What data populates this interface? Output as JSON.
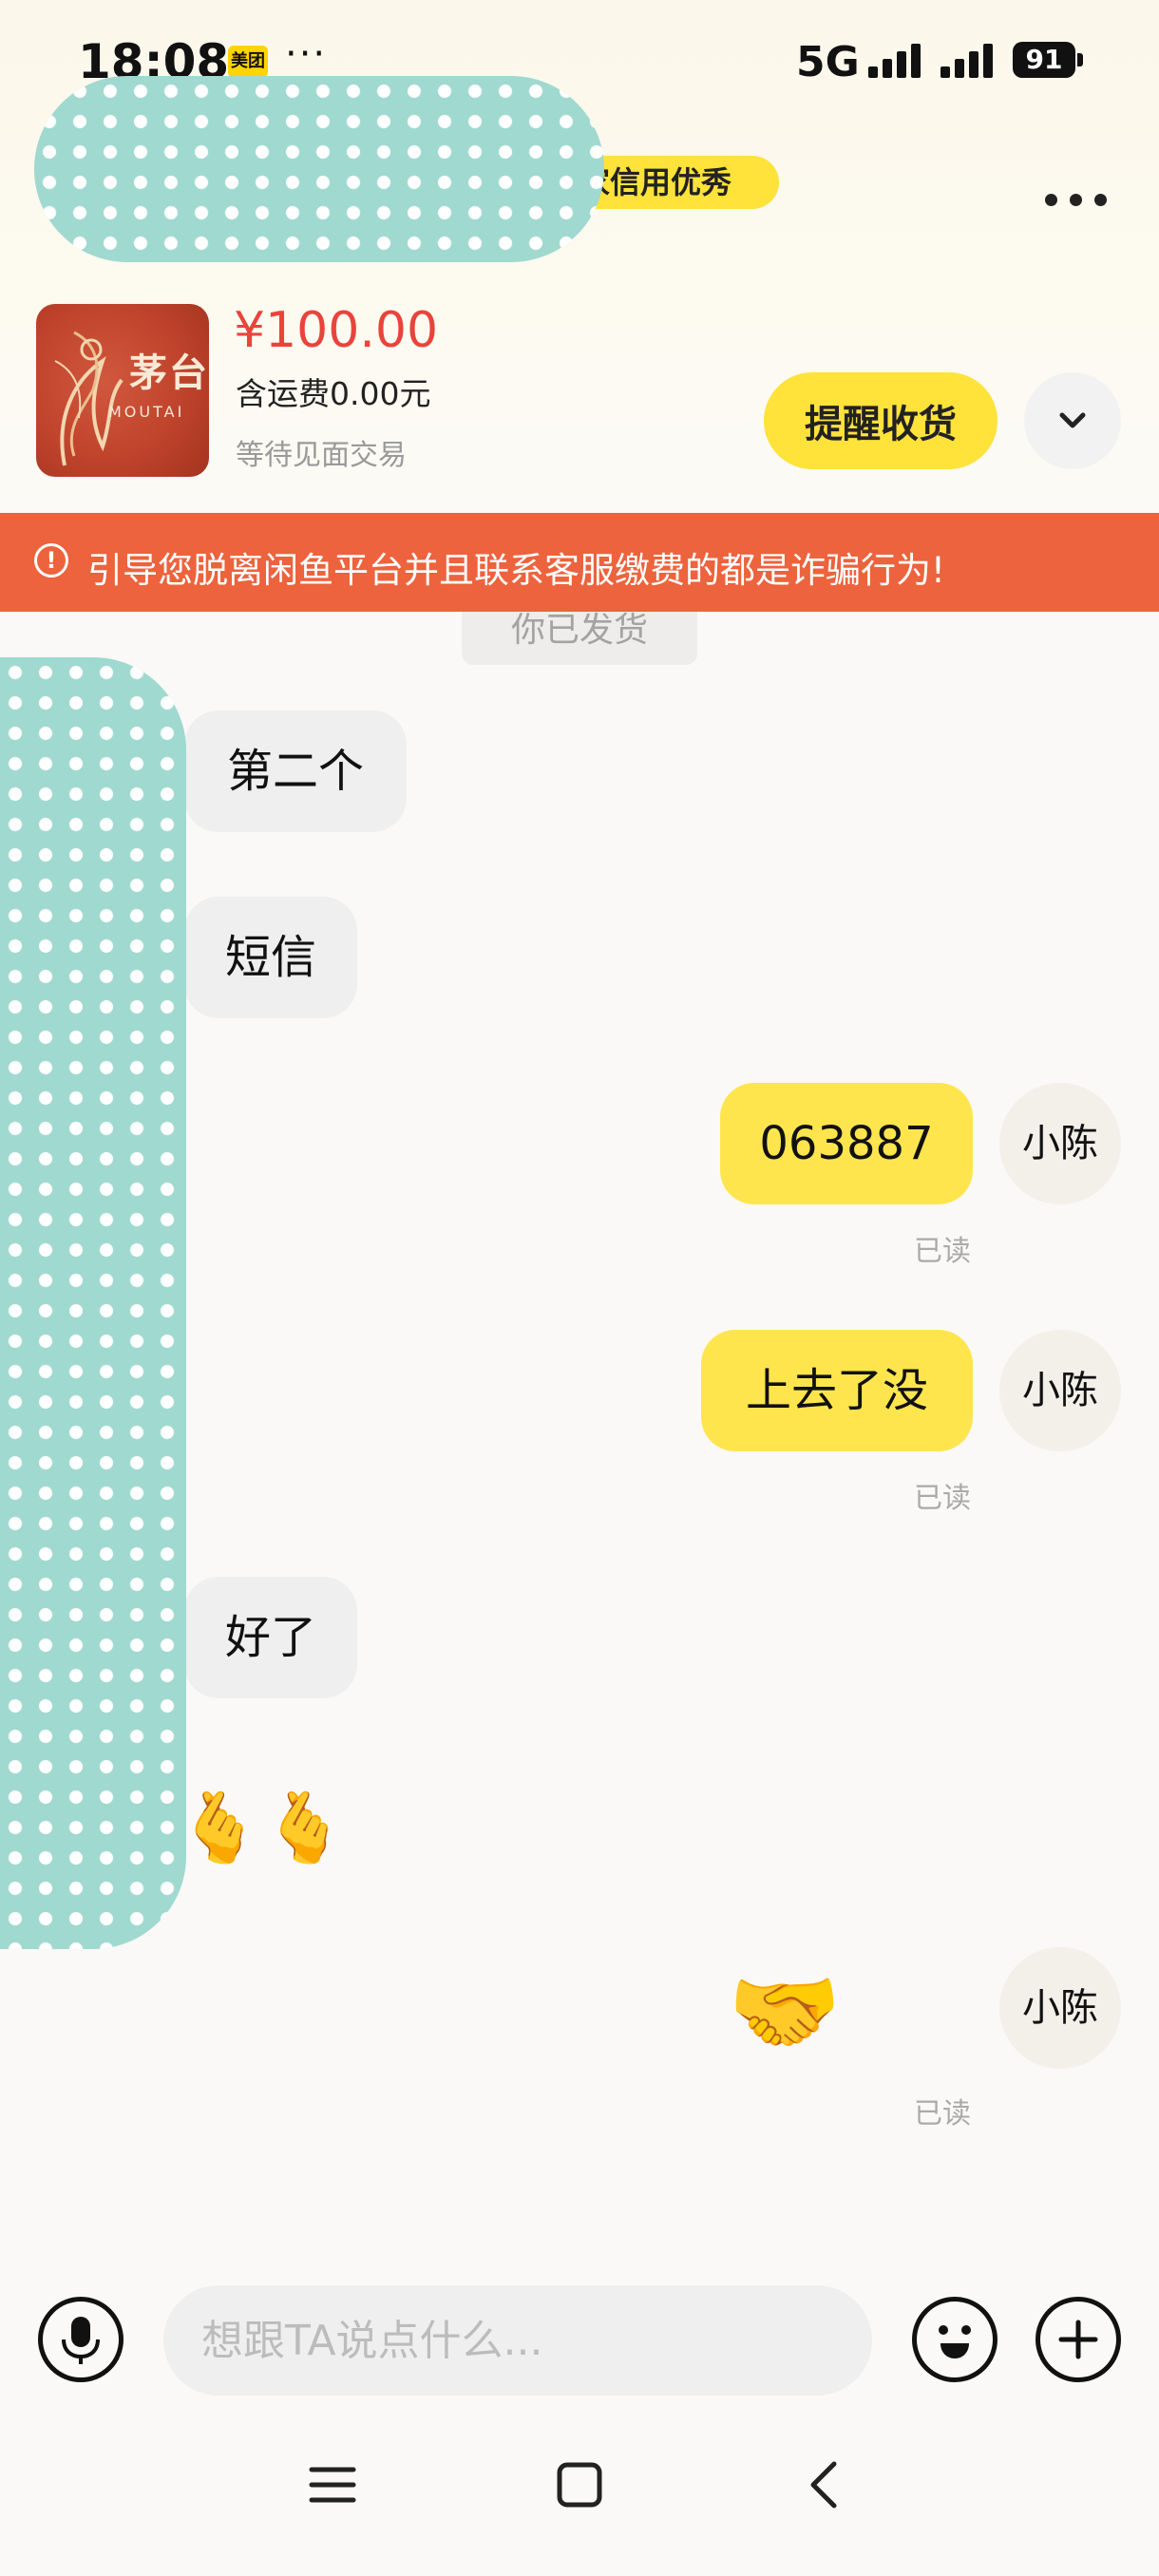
{
  "status_bar": {
    "time": "18:08",
    "app_badge": "美团",
    "more": "···",
    "network": "5G",
    "battery": "91"
  },
  "header": {
    "credit_badge": "家信用优秀",
    "menu_icon": "more-horizontal-icon"
  },
  "product": {
    "thumb_title": "茅台",
    "thumb_sub": "MOUTAI",
    "price": "¥100.00",
    "shipping": "含运费0.00元",
    "status": "等待见面交易",
    "remind_button": "提醒收货",
    "expand_icon": "chevron-down-icon"
  },
  "warning": {
    "icon": "alert-circle-icon",
    "text": "引导您脱离闲鱼平台并且联系客服缴费的都是诈骗行为!"
  },
  "chat": {
    "system_notice": "你已发货",
    "messages": [
      {
        "side": "in",
        "text": "第二个"
      },
      {
        "side": "in",
        "text": "短信"
      },
      {
        "side": "out",
        "text": "063887",
        "status": "已读",
        "avatar": "小陈"
      },
      {
        "side": "out",
        "text": "上去了没",
        "status": "已读",
        "avatar": "小陈"
      },
      {
        "side": "in",
        "text": "好了"
      },
      {
        "side": "in",
        "emoji": "🫰🫰"
      },
      {
        "side": "out",
        "emoji": "🤝",
        "status": "已读",
        "avatar": "小陈"
      }
    ]
  },
  "input_bar": {
    "voice_icon": "microphone-icon",
    "placeholder": "想跟TA说点什么...",
    "emoji_icon": "smiley-icon",
    "add_icon": "plus-icon"
  },
  "nav_bar": {
    "menu_icon": "menu-icon",
    "home_icon": "home-square-icon",
    "back_icon": "back-chevron-icon"
  },
  "colors": {
    "accent_yellow": "#ffe54d",
    "price_red": "#e8443c",
    "warning_orange": "#ec633d"
  }
}
